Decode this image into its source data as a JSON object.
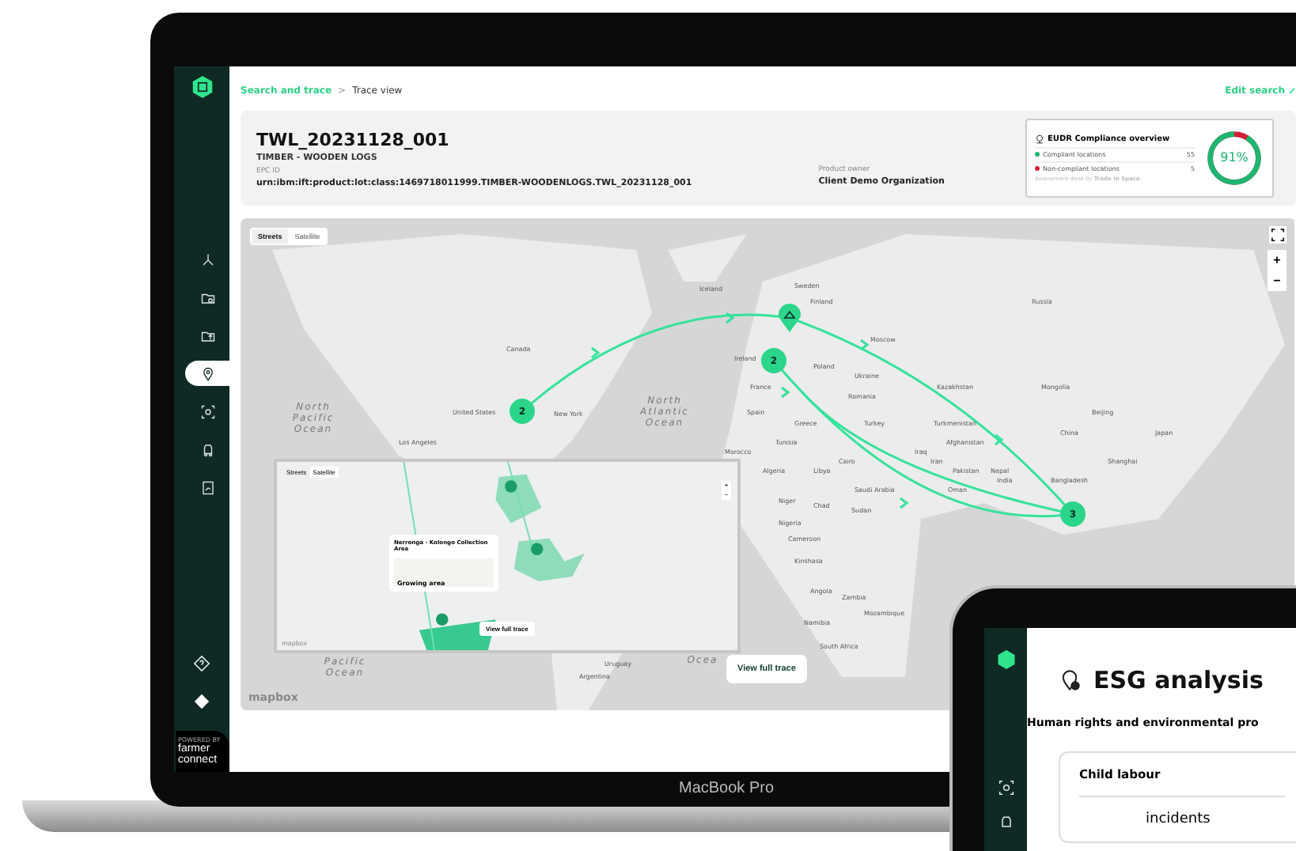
{
  "laptop": {
    "model": "MacBook Pro"
  },
  "sidebar": {
    "items": [
      {
        "kind": "network",
        "selected": false
      },
      {
        "kind": "folder",
        "selected": false
      },
      {
        "kind": "upload",
        "selected": false
      },
      {
        "kind": "pin",
        "selected": true
      },
      {
        "kind": "scan",
        "selected": false
      },
      {
        "kind": "truck",
        "selected": false
      },
      {
        "kind": "report",
        "selected": false
      }
    ],
    "help_items": [
      {
        "kind": "help"
      },
      {
        "kind": "badge"
      }
    ],
    "brand": {
      "caption": "POWERED BY",
      "name_1": "farmer",
      "name_2": "connect"
    }
  },
  "breadcrumb": {
    "link": "Search and trace",
    "separator": ">",
    "current": "Trace view",
    "action": "Edit search"
  },
  "product": {
    "title": "TWL_20231128_001",
    "subtitle": "TIMBER - WOODEN LOGS",
    "epc_label": "EPC ID",
    "epc": "urn:ibm:ift:product:lot:class:1469718011999.TIMBER-WOODENLOGS.TWL_20231128_001",
    "owner_label": "Product owner",
    "owner": "Client Demo Organization"
  },
  "compliance": {
    "title": "EUDR Compliance overview",
    "rows": [
      {
        "label": "Compliant locations",
        "count": "55",
        "color": "#1db56f"
      },
      {
        "label": "Non-compliant locations",
        "count": "5",
        "color": "#d0213a"
      }
    ],
    "footnote": "Assessment done by **Trade in Space**",
    "percent": "91%",
    "level": 0.91
  },
  "map": {
    "tabs": [
      {
        "label": "Streets",
        "selected": true
      },
      {
        "label": "Satellite",
        "selected": false
      }
    ],
    "zoom_in": "+",
    "zoom_out": "−",
    "attribution": "mapbox",
    "labels": [
      {
        "text": "Iceland",
        "kind": "place"
      },
      {
        "text": "Sweden",
        "kind": "place"
      },
      {
        "text": "Finland",
        "kind": "place"
      },
      {
        "text": "Russia",
        "kind": "place"
      },
      {
        "text": "Moscow",
        "kind": "place"
      },
      {
        "text": "Canada",
        "kind": "place"
      },
      {
        "text": "Ireland",
        "kind": "place"
      },
      {
        "text": "Poland",
        "kind": "place"
      },
      {
        "text": "Ukraine",
        "kind": "place"
      },
      {
        "text": "France",
        "kind": "place"
      },
      {
        "text": "Kazakhstan",
        "kind": "place"
      },
      {
        "text": "Mongolia",
        "kind": "place"
      },
      {
        "text": "Romania",
        "kind": "place"
      },
      {
        "text": "North Pacific Ocean",
        "kind": "ocean"
      },
      {
        "text": "United States",
        "kind": "place"
      },
      {
        "text": "New York",
        "kind": "place"
      },
      {
        "text": "North Atlantic Ocean",
        "kind": "ocean"
      },
      {
        "text": "Spain",
        "kind": "place"
      },
      {
        "text": "Beijing",
        "kind": "place"
      },
      {
        "text": "Greece",
        "kind": "place"
      },
      {
        "text": "Turkey",
        "kind": "place"
      },
      {
        "text": "Turkmenistan",
        "kind": "place"
      },
      {
        "text": "China",
        "kind": "place"
      },
      {
        "text": "Japan",
        "kind": "place"
      },
      {
        "text": "Los Angeles",
        "kind": "place"
      },
      {
        "text": "Tunisia",
        "kind": "place"
      },
      {
        "text": "Afghanistan",
        "kind": "place"
      },
      {
        "text": "Morocco",
        "kind": "place"
      },
      {
        "text": "Iraq",
        "kind": "place"
      },
      {
        "text": "Cairo",
        "kind": "place"
      },
      {
        "text": "Iran",
        "kind": "place"
      },
      {
        "text": "Shanghai",
        "kind": "place"
      },
      {
        "text": "Algeria",
        "kind": "place"
      },
      {
        "text": "Libya",
        "kind": "place"
      },
      {
        "text": "Pakistan",
        "kind": "place"
      },
      {
        "text": "Nepal",
        "kind": "place"
      },
      {
        "text": "India",
        "kind": "place"
      },
      {
        "text": "Bangladesh",
        "kind": "place"
      },
      {
        "text": "Saudi Arabia",
        "kind": "place"
      },
      {
        "text": "Oman",
        "kind": "place"
      },
      {
        "text": "Niger",
        "kind": "place"
      },
      {
        "text": "Chad",
        "kind": "place"
      },
      {
        "text": "Sudan",
        "kind": "place"
      },
      {
        "text": "Nigeria",
        "kind": "place"
      },
      {
        "text": "Cameroon",
        "kind": "place"
      },
      {
        "text": "Kinshasa",
        "kind": "place"
      },
      {
        "text": "Angola",
        "kind": "place"
      },
      {
        "text": "Zambia",
        "kind": "place"
      },
      {
        "text": "Mozambique",
        "kind": "place"
      },
      {
        "text": "Namibia",
        "kind": "place"
      },
      {
        "text": "South Africa",
        "kind": "place"
      },
      {
        "text": "Pacific Ocean",
        "kind": "ocean"
      },
      {
        "text": "Uruguay",
        "kind": "place"
      },
      {
        "text": "Ocea",
        "kind": "ocean"
      },
      {
        "text": "Argentina",
        "kind": "place"
      }
    ],
    "clusters": [
      "2",
      "2",
      "3"
    ],
    "button": "View full trace",
    "inset": {
      "tabs": [
        {
          "label": "Streets",
          "selected": true
        },
        {
          "label": "Satellite",
          "selected": false
        }
      ],
      "zoom_in": "+",
      "zoom_out": "−",
      "popup": {
        "title": "Nerronga - Kolongo Collection Area",
        "section": "Growing area"
      },
      "button": "View full trace",
      "attribution": "mapbox"
    }
  },
  "tablet": {
    "title": "ESG analysis",
    "subtitle": "Human rights and environmental pro",
    "card_title": "Child labour",
    "card_text": "incidents"
  }
}
